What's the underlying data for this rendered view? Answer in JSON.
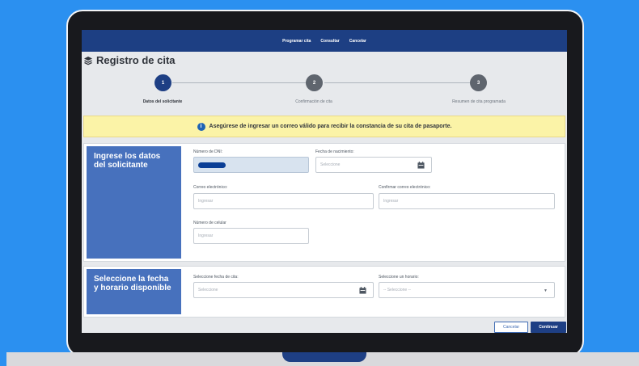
{
  "nav": {
    "items": [
      "Programar cita",
      "Consultar",
      "Cancelar"
    ]
  },
  "page": {
    "title": "Registro de cita"
  },
  "stepper": {
    "steps": [
      {
        "number": "1",
        "label": "Datos del solicitante",
        "status": "active"
      },
      {
        "number": "2",
        "label": "Confirmación de cita",
        "status": "pending"
      },
      {
        "number": "3",
        "label": "Resumen de cita programada",
        "status": "pending"
      }
    ]
  },
  "notice": {
    "text": "Asegúrese de ingresar un correo válido para recibir la constancia de su cita de pasaporte."
  },
  "applicant": {
    "heading": "Ingrese los datos del solicitante",
    "dni": {
      "label": "Número de DNI:",
      "value": ""
    },
    "birthdate": {
      "label": "Fecha de nacimiento:",
      "placeholder": "Seleccione"
    },
    "email": {
      "label": "Correo electrónico:",
      "placeholder": "Ingresar"
    },
    "email_confirm": {
      "label": "Confirmar correo electrónico:",
      "placeholder": "Ingresar"
    },
    "phone": {
      "label": "Número de celular",
      "placeholder": "Ingresar"
    }
  },
  "schedule": {
    "heading": "Seleccione la fecha y horario disponible",
    "date": {
      "label": "Seleccione fecha de cita:",
      "placeholder": "Seleccione"
    },
    "time": {
      "label": "Seleccione un horario:",
      "placeholder": "-- Seleccione --"
    }
  },
  "actions": {
    "cancel": "Cancelar",
    "continue": "Continuar"
  },
  "colors": {
    "navy": "#1d3f83",
    "sidebar_blue": "#4771bd",
    "notice_yellow": "#fbf3a7",
    "background_blue": "#2b90f0"
  }
}
